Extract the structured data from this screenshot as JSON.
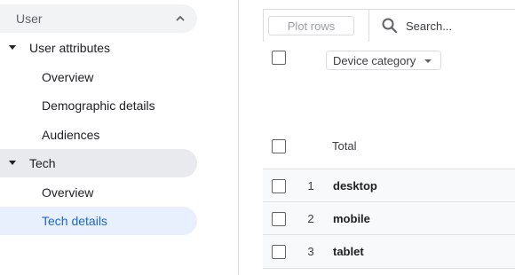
{
  "sidebar": {
    "section_title": "User",
    "groups": [
      {
        "label": "User attributes",
        "items": [
          "Overview",
          "Demographic details",
          "Audiences"
        ]
      },
      {
        "label": "Tech",
        "items": [
          "Overview",
          "Tech details"
        ]
      }
    ],
    "active_item": "Tech details"
  },
  "toolbar": {
    "plot_rows_label": "Plot rows",
    "search_placeholder": "Search..."
  },
  "table": {
    "dimension_selector": "Device category",
    "total_label": "Total",
    "rows": [
      {
        "index": "1",
        "value": "desktop"
      },
      {
        "index": "2",
        "value": "mobile"
      },
      {
        "index": "3",
        "value": "tablet"
      }
    ]
  },
  "colors": {
    "active_bg": "#e8f0fe",
    "active_text": "#1967d2",
    "hover_bg": "#e8eaed",
    "border": "#dadce0"
  }
}
